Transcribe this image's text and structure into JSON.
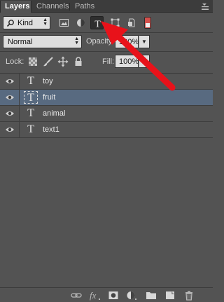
{
  "tabs": [
    {
      "label": "Layers",
      "active": true
    },
    {
      "label": "Channels",
      "active": false
    },
    {
      "label": "Paths",
      "active": false
    }
  ],
  "filter": {
    "kind_label": "Kind",
    "icons": [
      "image-filter-icon",
      "adjustment-filter-icon",
      "type-filter-icon",
      "shape-filter-icon",
      "smart-object-filter-icon"
    ],
    "active_filter": "type-filter-icon",
    "toggle_color": "#d4504c"
  },
  "blend": {
    "mode": "Normal",
    "opacity_label": "Opacity:",
    "opacity_value": "100%"
  },
  "lock": {
    "label": "Lock:",
    "icons": [
      "lock-transparent-icon",
      "lock-image-icon",
      "lock-position-icon",
      "lock-all-icon"
    ],
    "fill_label": "Fill:",
    "fill_value": "100%"
  },
  "layers": [
    {
      "name": "toy",
      "type": "text",
      "visible": true,
      "selected": false
    },
    {
      "name": "fruit",
      "type": "text",
      "visible": true,
      "selected": true
    },
    {
      "name": "animal",
      "type": "text",
      "visible": true,
      "selected": false
    },
    {
      "name": "text1",
      "type": "text",
      "visible": true,
      "selected": false
    }
  ],
  "thumb_glyph": "T",
  "footer_icons": [
    "link-icon",
    "fx-icon",
    "mask-icon",
    "adjustment-layer-icon",
    "group-folder-icon",
    "new-layer-icon",
    "trash-icon"
  ],
  "colors": {
    "panel_bg": "#535353",
    "selected_row": "#586a80",
    "annotation_arrow": "#e8121a"
  }
}
